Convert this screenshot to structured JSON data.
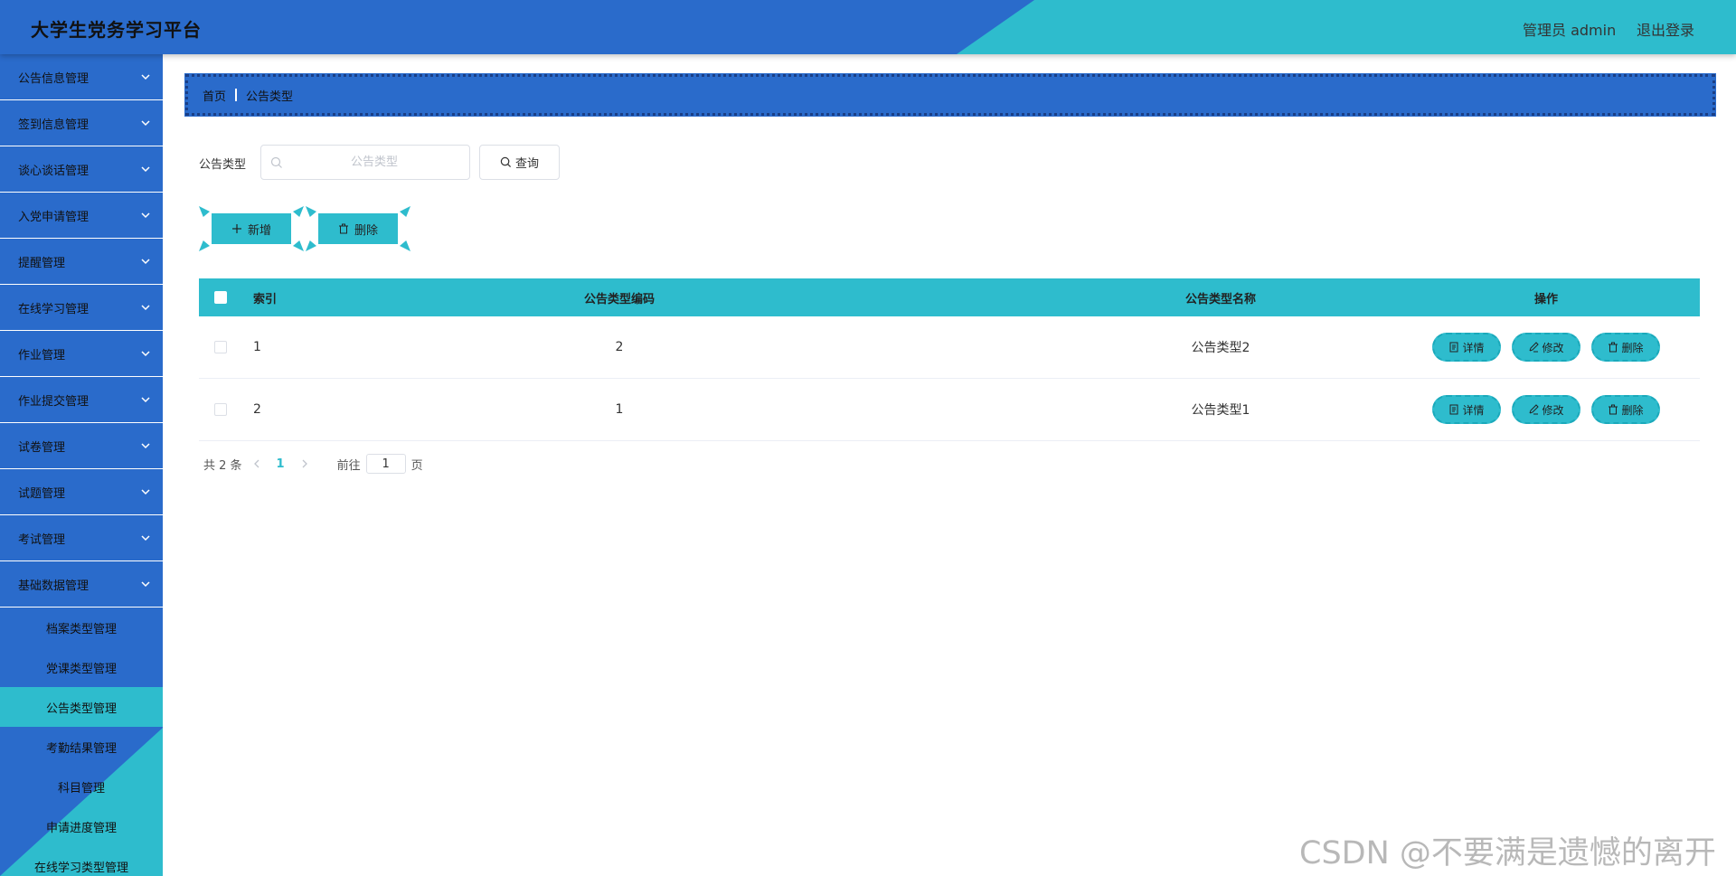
{
  "header": {
    "app_title": "大学生党务学习平台",
    "user_label": "管理员 admin",
    "logout_label": "退出登录"
  },
  "sidebar": {
    "menus": [
      {
        "label": "公告信息管理"
      },
      {
        "label": "签到信息管理"
      },
      {
        "label": "谈心谈话管理"
      },
      {
        "label": "入党申请管理"
      },
      {
        "label": "提醒管理"
      },
      {
        "label": "在线学习管理"
      },
      {
        "label": "作业管理"
      },
      {
        "label": "作业提交管理"
      },
      {
        "label": "试卷管理"
      },
      {
        "label": "试题管理"
      },
      {
        "label": "考试管理"
      },
      {
        "label": "基础数据管理"
      }
    ],
    "submenus": [
      {
        "label": "档案类型管理"
      },
      {
        "label": "党课类型管理"
      },
      {
        "label": "公告类型管理",
        "active": true
      },
      {
        "label": "考勤结果管理"
      },
      {
        "label": "科目管理"
      },
      {
        "label": "申请进度管理"
      },
      {
        "label": "在线学习类型管理"
      }
    ]
  },
  "breadcrumb": {
    "home": "首页",
    "current": "公告类型"
  },
  "search": {
    "label": "公告类型",
    "placeholder": "公告类型",
    "value": "",
    "query_button": "查询"
  },
  "actions": {
    "add_label": "新增",
    "delete_label": "删除"
  },
  "table": {
    "columns": [
      "索引",
      "公告类型编码",
      "公告类型名称",
      "操作"
    ],
    "rows": [
      {
        "index": "1",
        "code": "2",
        "name": "公告类型2"
      },
      {
        "index": "2",
        "code": "1",
        "name": "公告类型1"
      }
    ],
    "row_ops": {
      "detail": "详情",
      "edit": "修改",
      "delete": "删除"
    }
  },
  "pagination": {
    "total_text": "共 2 条",
    "current_page": "1",
    "goto_prefix": "前往",
    "goto_value": "1",
    "goto_suffix": "页"
  },
  "watermark": "CSDN @不要满是遗憾的离开",
  "colors": {
    "primary_blue": "#2a6bcb",
    "accent_cyan": "#2ebccd"
  },
  "icons": {
    "chevron": "chevron-down-icon",
    "search": "search-icon",
    "add": "plus-icon",
    "delete": "trash-icon",
    "detail": "document-icon",
    "edit": "pencil-icon"
  }
}
